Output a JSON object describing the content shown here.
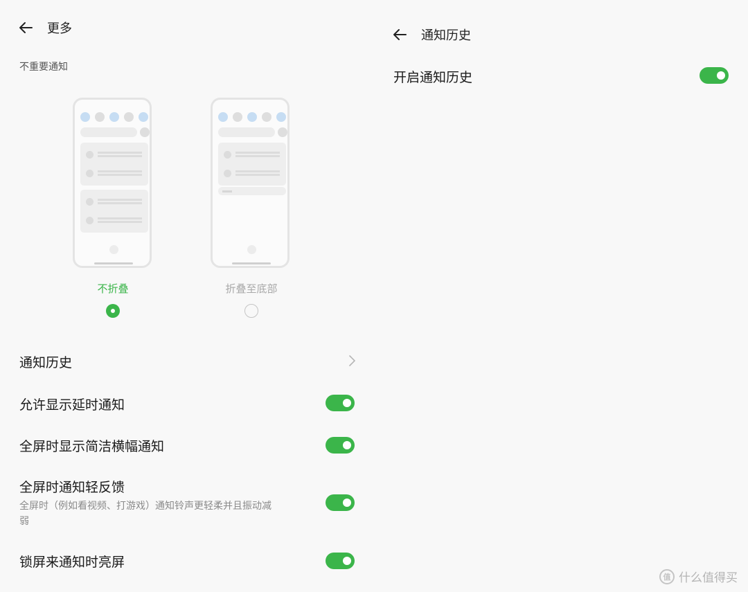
{
  "left": {
    "title": "更多",
    "section_label": "不重要通知",
    "options": [
      {
        "label": "不折叠",
        "selected": true,
        "color": "#3bb54a"
      },
      {
        "label": "折叠至底部",
        "selected": false,
        "color": "#a8a8a8"
      }
    ],
    "notification_history": "通知历史",
    "settings": [
      {
        "label": "允许显示延时通知",
        "enabled": true
      },
      {
        "label": "全屏时显示简洁横幅通知",
        "enabled": true
      },
      {
        "label": "全屏时通知轻反馈",
        "enabled": true,
        "description_line1": "全屏时（例如看视频、打游戏）通知铃声更轻柔并且振动减",
        "description_line2": "弱"
      },
      {
        "label": "锁屏来通知时亮屏",
        "enabled": true
      }
    ]
  },
  "right": {
    "title": "通知历史",
    "setting": {
      "label": "开启通知历史",
      "enabled": true
    }
  },
  "watermark": {
    "text": "什么值得买",
    "logo_text": "值"
  },
  "colors": {
    "accent": "#3bb54a",
    "background": "#f8f8f8"
  }
}
